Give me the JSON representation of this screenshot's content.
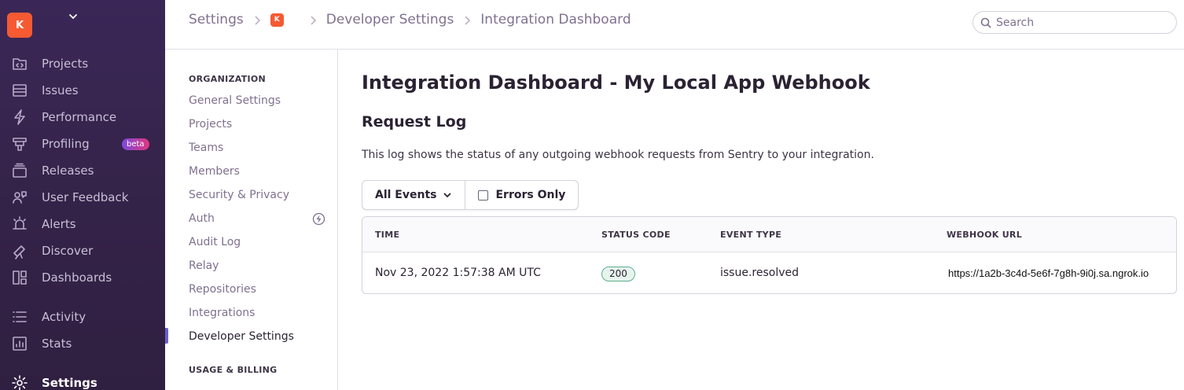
{
  "sidebar": {
    "org_initial": "K",
    "items": [
      {
        "label": "Projects",
        "icon": "projects-icon"
      },
      {
        "label": "Issues",
        "icon": "issues-icon"
      },
      {
        "label": "Performance",
        "icon": "performance-icon"
      },
      {
        "label": "Profiling",
        "icon": "profiling-icon",
        "badge": "beta"
      },
      {
        "label": "Releases",
        "icon": "releases-icon"
      },
      {
        "label": "User Feedback",
        "icon": "user-feedback-icon"
      },
      {
        "label": "Alerts",
        "icon": "alerts-icon"
      },
      {
        "label": "Discover",
        "icon": "discover-icon"
      },
      {
        "label": "Dashboards",
        "icon": "dashboards-icon"
      },
      {
        "label": "Activity",
        "icon": "activity-icon"
      },
      {
        "label": "Stats",
        "icon": "stats-icon"
      },
      {
        "label": "Settings",
        "icon": "settings-icon",
        "active": true
      }
    ]
  },
  "header": {
    "breadcrumbs": [
      "Settings",
      "Developer Settings",
      "Integration Dashboard"
    ],
    "org_mini_initial": "K",
    "search_placeholder": "Search"
  },
  "subnav": {
    "sections": [
      {
        "heading": "ORGANIZATION",
        "items": [
          "General Settings",
          "Projects",
          "Teams",
          "Members",
          "Security & Privacy",
          "Auth",
          "Audit Log",
          "Relay",
          "Repositories",
          "Integrations",
          "Developer Settings"
        ]
      },
      {
        "heading": "USAGE & BILLING",
        "items": []
      }
    ],
    "active_item": "Developer Settings"
  },
  "main": {
    "title": "Integration Dashboard - My Local App Webhook",
    "section_title": "Request Log",
    "description": "This log shows the status of any outgoing webhook requests from Sentry to your integration.",
    "filters": {
      "events_dropdown": "All Events",
      "errors_only_label": "Errors Only",
      "errors_only_checked": false
    },
    "table": {
      "headers": [
        "TIME",
        "STATUS CODE",
        "EVENT TYPE",
        "WEBHOOK URL"
      ],
      "rows": [
        {
          "time": "Nov 23, 2022 1:57:38 AM UTC",
          "status_code": "200",
          "event_type": "issue.resolved",
          "webhook_url": "https://1a2b-3c4d-5e6f-7g8h-9i0j.sa.ngrok.io"
        }
      ]
    }
  },
  "colors": {
    "sidebar_bg": "#3b2757",
    "org_avatar": "#f55a32",
    "accent": "#6c5fc7",
    "status_ok": "#5fae8d"
  }
}
